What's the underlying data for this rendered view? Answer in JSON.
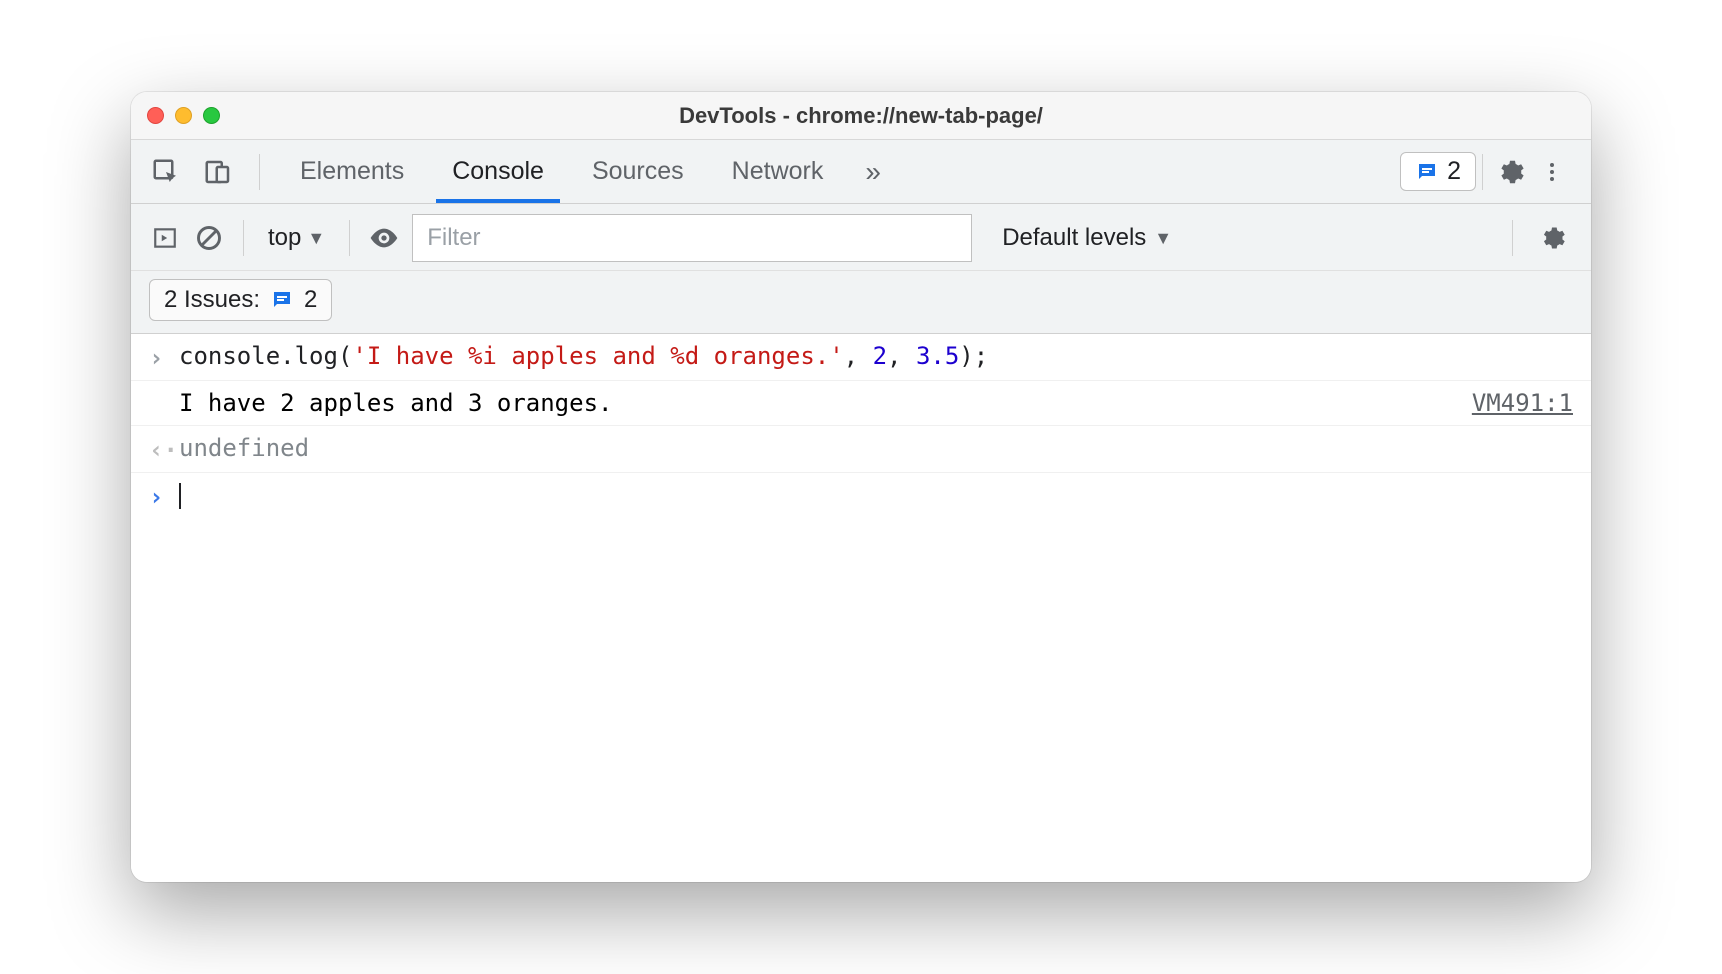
{
  "window": {
    "title": "DevTools - chrome://new-tab-page/"
  },
  "tabs": {
    "items": [
      "Elements",
      "Console",
      "Sources",
      "Network"
    ],
    "active": "Console",
    "overflow_glyph": "»",
    "issues_count": "2"
  },
  "toolbar": {
    "context": "top",
    "filter_placeholder": "Filter",
    "levels_label": "Default levels"
  },
  "issues": {
    "label": "2 Issues:",
    "count": "2"
  },
  "console": {
    "input_prefix": "console.log(",
    "input_string": "'I have %i apples and %d oranges.'",
    "input_sep1": ", ",
    "input_arg1": "2",
    "input_sep2": ", ",
    "input_arg2": "3.5",
    "input_suffix": ");",
    "output_text": "I have 2 apples and 3 oranges.",
    "output_source": "VM491:1",
    "return_value": "undefined"
  }
}
